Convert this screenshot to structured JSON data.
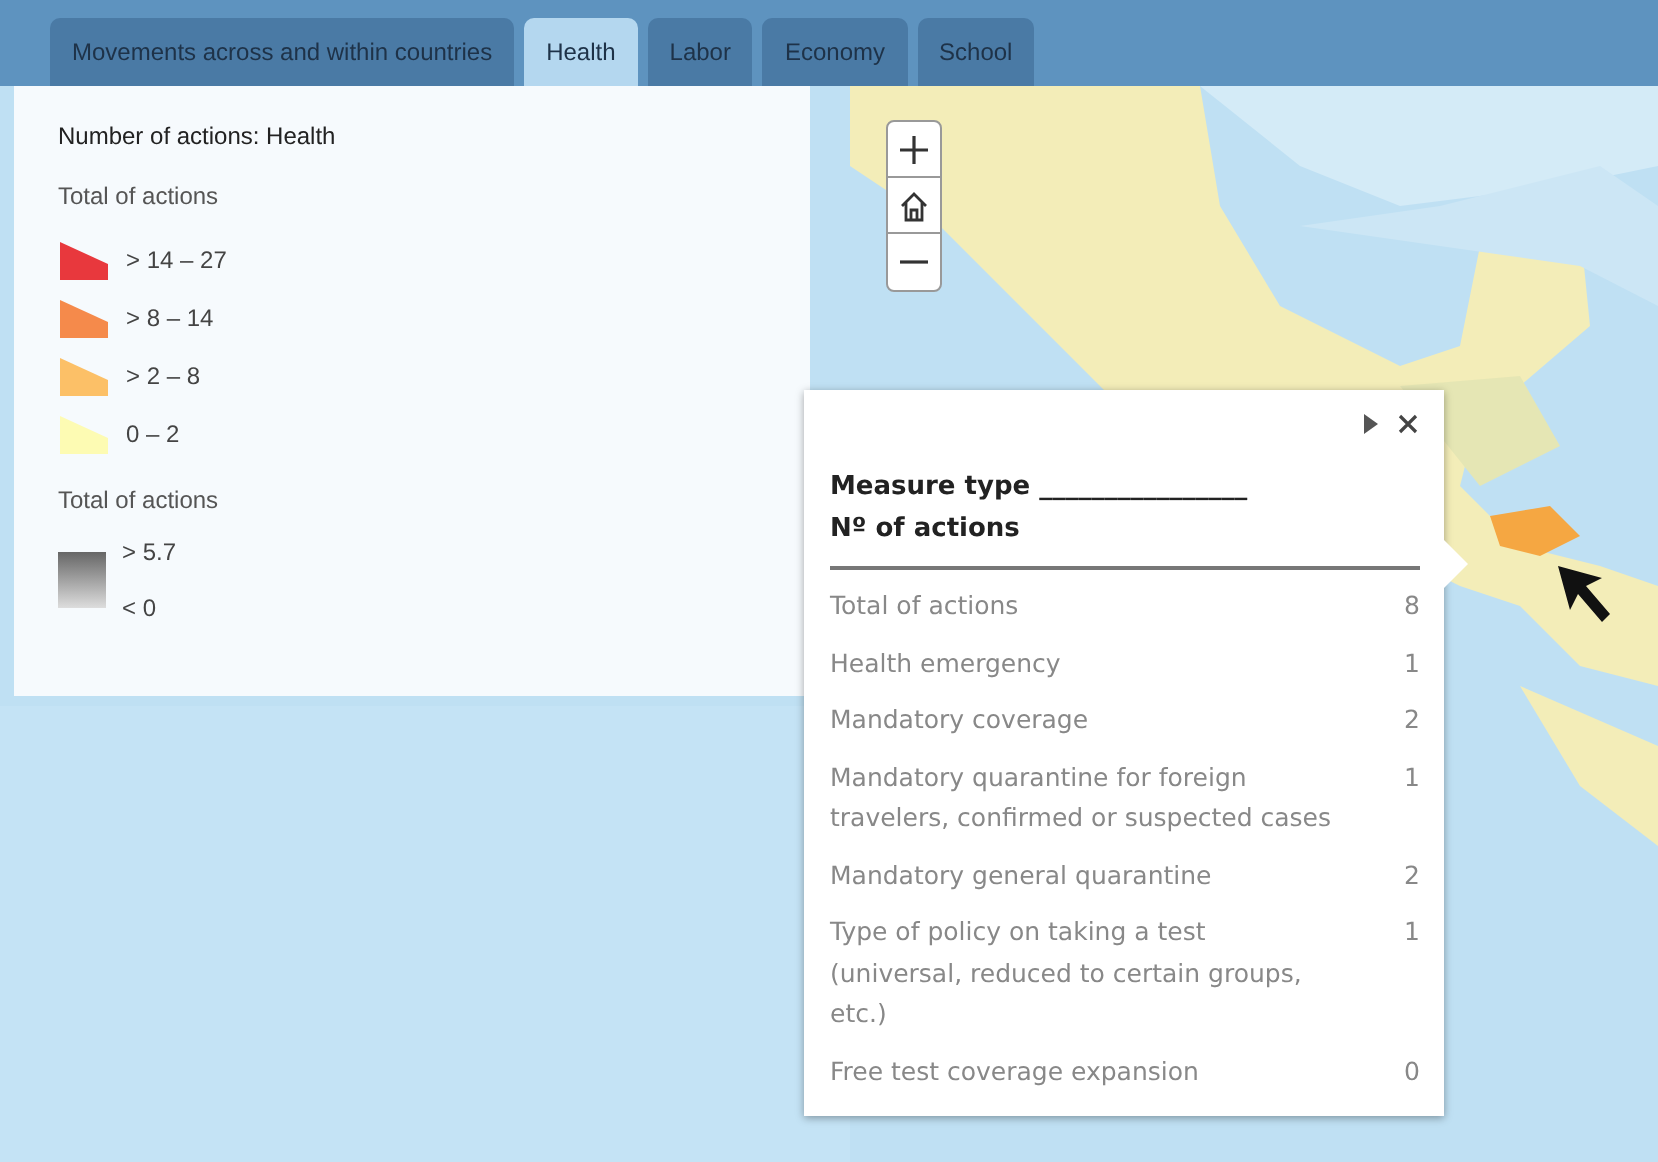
{
  "tabs": [
    {
      "label": "Movements across and within countries",
      "selected": false
    },
    {
      "label": "Health",
      "selected": true
    },
    {
      "label": "Labor",
      "selected": false
    },
    {
      "label": "Economy",
      "selected": false
    },
    {
      "label": "School",
      "selected": false
    }
  ],
  "legend": {
    "title": "Number of actions: Health",
    "sections": [
      {
        "kind": "classes",
        "heading": "Total of actions",
        "items": [
          {
            "label": "> 14 – 27",
            "color": "#e8383d"
          },
          {
            "label": "> 8 – 14",
            "color": "#f58a4b"
          },
          {
            "label": "> 2 – 8",
            "color": "#fcc067"
          },
          {
            "label": "0 – 2",
            "color": "#fdfbb3"
          }
        ]
      },
      {
        "kind": "gradient",
        "heading": "Total of actions",
        "high": "> 5.7",
        "low": "< 0"
      }
    ]
  },
  "popup": {
    "heading_line_1": "Measure type ________________",
    "heading_line_2": "Nº of actions",
    "rows": [
      {
        "label": "Total of actions",
        "value": "8"
      },
      {
        "label": "Health emergency",
        "value": "1"
      },
      {
        "label": "Mandatory coverage",
        "value": "2"
      },
      {
        "label": "Mandatory quarantine for foreign travelers, confirmed or suspected cases",
        "value": "1"
      },
      {
        "label": "Mandatory general quarantine",
        "value": "2"
      },
      {
        "label": "Type of policy on taking a test (universal, reduced to certain groups, etc.)",
        "value": "1"
      },
      {
        "label": "Free test coverage expansion",
        "value": "0"
      }
    ]
  }
}
